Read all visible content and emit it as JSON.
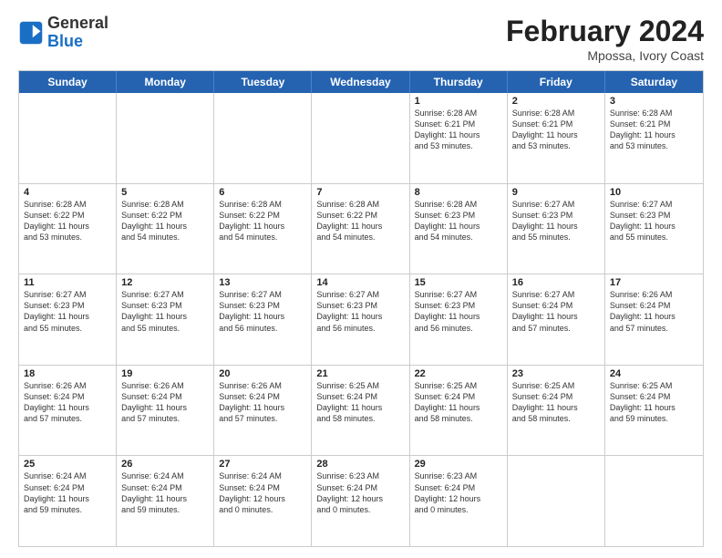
{
  "logo": {
    "general": "General",
    "blue": "Blue"
  },
  "header": {
    "title": "February 2024",
    "subtitle": "Mpossa, Ivory Coast"
  },
  "days": [
    "Sunday",
    "Monday",
    "Tuesday",
    "Wednesday",
    "Thursday",
    "Friday",
    "Saturday"
  ],
  "weeks": [
    [
      {
        "day": "",
        "info": ""
      },
      {
        "day": "",
        "info": ""
      },
      {
        "day": "",
        "info": ""
      },
      {
        "day": "",
        "info": ""
      },
      {
        "day": "1",
        "info": "Sunrise: 6:28 AM\nSunset: 6:21 PM\nDaylight: 11 hours\nand 53 minutes."
      },
      {
        "day": "2",
        "info": "Sunrise: 6:28 AM\nSunset: 6:21 PM\nDaylight: 11 hours\nand 53 minutes."
      },
      {
        "day": "3",
        "info": "Sunrise: 6:28 AM\nSunset: 6:21 PM\nDaylight: 11 hours\nand 53 minutes."
      }
    ],
    [
      {
        "day": "4",
        "info": "Sunrise: 6:28 AM\nSunset: 6:22 PM\nDaylight: 11 hours\nand 53 minutes."
      },
      {
        "day": "5",
        "info": "Sunrise: 6:28 AM\nSunset: 6:22 PM\nDaylight: 11 hours\nand 54 minutes."
      },
      {
        "day": "6",
        "info": "Sunrise: 6:28 AM\nSunset: 6:22 PM\nDaylight: 11 hours\nand 54 minutes."
      },
      {
        "day": "7",
        "info": "Sunrise: 6:28 AM\nSunset: 6:22 PM\nDaylight: 11 hours\nand 54 minutes."
      },
      {
        "day": "8",
        "info": "Sunrise: 6:28 AM\nSunset: 6:23 PM\nDaylight: 11 hours\nand 54 minutes."
      },
      {
        "day": "9",
        "info": "Sunrise: 6:27 AM\nSunset: 6:23 PM\nDaylight: 11 hours\nand 55 minutes."
      },
      {
        "day": "10",
        "info": "Sunrise: 6:27 AM\nSunset: 6:23 PM\nDaylight: 11 hours\nand 55 minutes."
      }
    ],
    [
      {
        "day": "11",
        "info": "Sunrise: 6:27 AM\nSunset: 6:23 PM\nDaylight: 11 hours\nand 55 minutes."
      },
      {
        "day": "12",
        "info": "Sunrise: 6:27 AM\nSunset: 6:23 PM\nDaylight: 11 hours\nand 55 minutes."
      },
      {
        "day": "13",
        "info": "Sunrise: 6:27 AM\nSunset: 6:23 PM\nDaylight: 11 hours\nand 56 minutes."
      },
      {
        "day": "14",
        "info": "Sunrise: 6:27 AM\nSunset: 6:23 PM\nDaylight: 11 hours\nand 56 minutes."
      },
      {
        "day": "15",
        "info": "Sunrise: 6:27 AM\nSunset: 6:23 PM\nDaylight: 11 hours\nand 56 minutes."
      },
      {
        "day": "16",
        "info": "Sunrise: 6:27 AM\nSunset: 6:24 PM\nDaylight: 11 hours\nand 57 minutes."
      },
      {
        "day": "17",
        "info": "Sunrise: 6:26 AM\nSunset: 6:24 PM\nDaylight: 11 hours\nand 57 minutes."
      }
    ],
    [
      {
        "day": "18",
        "info": "Sunrise: 6:26 AM\nSunset: 6:24 PM\nDaylight: 11 hours\nand 57 minutes."
      },
      {
        "day": "19",
        "info": "Sunrise: 6:26 AM\nSunset: 6:24 PM\nDaylight: 11 hours\nand 57 minutes."
      },
      {
        "day": "20",
        "info": "Sunrise: 6:26 AM\nSunset: 6:24 PM\nDaylight: 11 hours\nand 57 minutes."
      },
      {
        "day": "21",
        "info": "Sunrise: 6:25 AM\nSunset: 6:24 PM\nDaylight: 11 hours\nand 58 minutes."
      },
      {
        "day": "22",
        "info": "Sunrise: 6:25 AM\nSunset: 6:24 PM\nDaylight: 11 hours\nand 58 minutes."
      },
      {
        "day": "23",
        "info": "Sunrise: 6:25 AM\nSunset: 6:24 PM\nDaylight: 11 hours\nand 58 minutes."
      },
      {
        "day": "24",
        "info": "Sunrise: 6:25 AM\nSunset: 6:24 PM\nDaylight: 11 hours\nand 59 minutes."
      }
    ],
    [
      {
        "day": "25",
        "info": "Sunrise: 6:24 AM\nSunset: 6:24 PM\nDaylight: 11 hours\nand 59 minutes."
      },
      {
        "day": "26",
        "info": "Sunrise: 6:24 AM\nSunset: 6:24 PM\nDaylight: 11 hours\nand 59 minutes."
      },
      {
        "day": "27",
        "info": "Sunrise: 6:24 AM\nSunset: 6:24 PM\nDaylight: 12 hours\nand 0 minutes."
      },
      {
        "day": "28",
        "info": "Sunrise: 6:23 AM\nSunset: 6:24 PM\nDaylight: 12 hours\nand 0 minutes."
      },
      {
        "day": "29",
        "info": "Sunrise: 6:23 AM\nSunset: 6:24 PM\nDaylight: 12 hours\nand 0 minutes."
      },
      {
        "day": "",
        "info": ""
      },
      {
        "day": "",
        "info": ""
      }
    ]
  ]
}
